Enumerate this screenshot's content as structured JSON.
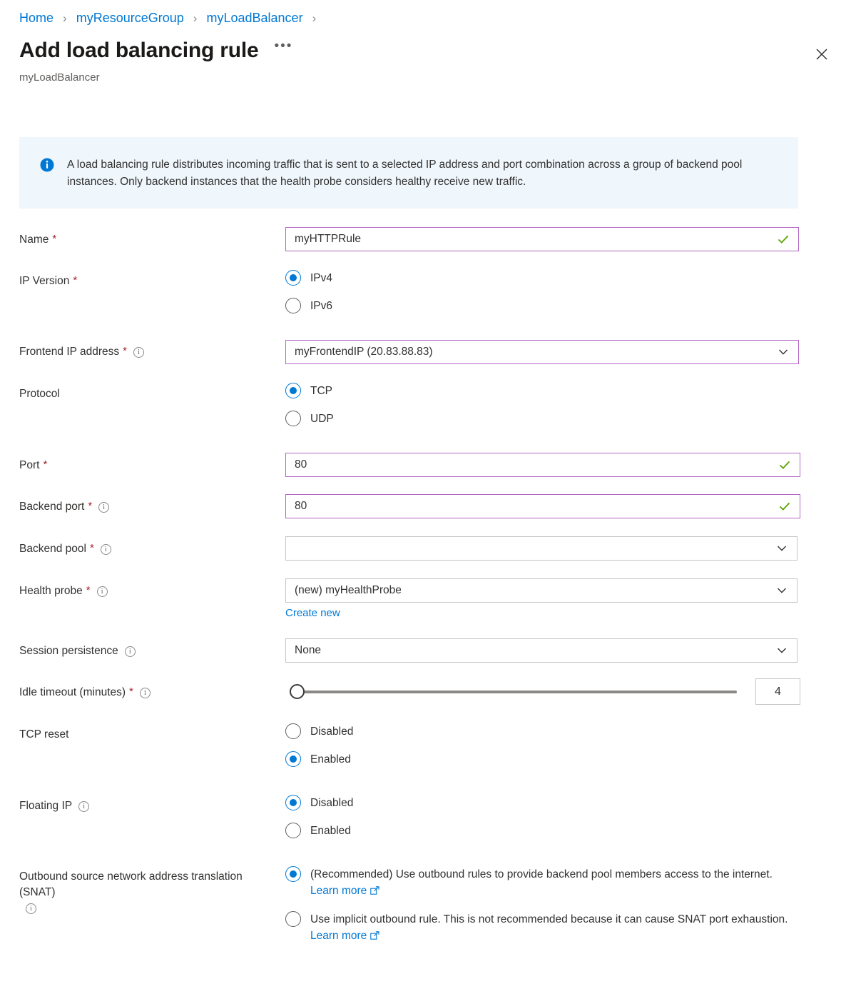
{
  "breadcrumb": {
    "items": [
      "Home",
      "myResourceGroup",
      "myLoadBalancer"
    ],
    "separator": "›"
  },
  "header": {
    "title": "Add load balancing rule",
    "subtitle": "myLoadBalancer",
    "more_label": "•••",
    "close_label": "Close"
  },
  "info_banner": {
    "text": "A load balancing rule distributes incoming traffic that is sent to a selected IP address and port combination across a group of backend pool instances. Only backend instances that the health probe considers healthy receive new traffic."
  },
  "form": {
    "name": {
      "label": "Name",
      "required": "*",
      "value": "myHTTPRule",
      "valid": "✓"
    },
    "ip_version": {
      "label": "IP Version",
      "required": "*",
      "options": [
        {
          "label": "IPv4",
          "selected": true
        },
        {
          "label": "IPv6",
          "selected": false
        }
      ]
    },
    "frontend_ip": {
      "label": "Frontend IP address",
      "required": "*",
      "value": "myFrontendIP (20.83.88.83)"
    },
    "protocol": {
      "label": "Protocol",
      "options": [
        {
          "label": "TCP",
          "selected": true
        },
        {
          "label": "UDP",
          "selected": false
        }
      ]
    },
    "port": {
      "label": "Port",
      "required": "*",
      "value": "80",
      "valid": "✓"
    },
    "backend_port": {
      "label": "Backend port",
      "required": "*",
      "value": "80",
      "valid": "✓"
    },
    "backend_pool": {
      "label": "Backend pool",
      "required": "*",
      "value": ""
    },
    "health_probe": {
      "label": "Health probe",
      "required": "*",
      "value": "(new) myHealthProbe",
      "create_new_label": "Create new"
    },
    "session_persistence": {
      "label": "Session persistence",
      "value": "None"
    },
    "idle_timeout": {
      "label": "Idle timeout (minutes)",
      "required": "*",
      "value": "4",
      "min": 4,
      "max": 30
    },
    "tcp_reset": {
      "label": "TCP reset",
      "options": [
        {
          "label": "Disabled",
          "selected": false
        },
        {
          "label": "Enabled",
          "selected": true
        }
      ]
    },
    "floating_ip": {
      "label": "Floating IP",
      "options": [
        {
          "label": "Disabled",
          "selected": true
        },
        {
          "label": "Enabled",
          "selected": false
        }
      ]
    },
    "snat": {
      "label": "Outbound source network address translation (SNAT)",
      "options": [
        {
          "text": "(Recommended) Use outbound rules to provide backend pool members access to the internet.",
          "link": "Learn more",
          "selected": true
        },
        {
          "text": "Use implicit outbound rule. This is not recommended because it can cause SNAT port exhaustion.",
          "link": "Learn more",
          "selected": false
        }
      ]
    }
  },
  "colors": {
    "link": "#0078d4",
    "accent": "#0078d4",
    "required_star": "#a4262c",
    "valid_check": "#57a300",
    "focus_border": "#b366c4",
    "banner_bg": "#eff6fc"
  }
}
